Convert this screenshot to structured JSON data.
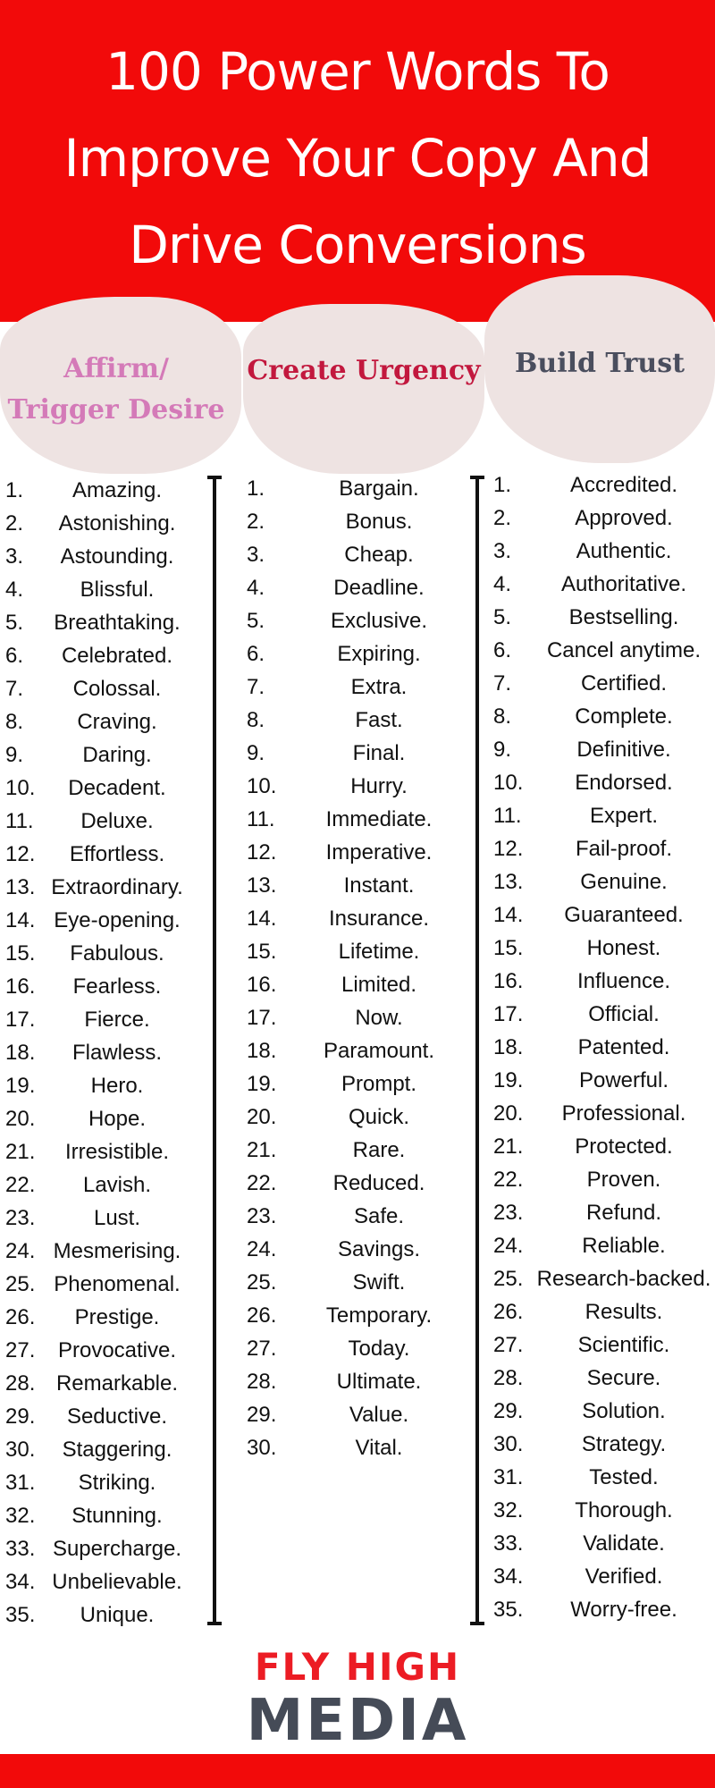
{
  "title": {
    "line1": "100 Power Words To",
    "line2": "Improve Your Copy And",
    "line3": "Drive Conversions"
  },
  "categories": {
    "affirm": {
      "line1": "Affirm/",
      "line2": "Trigger Desire"
    },
    "urgency": {
      "label": "Create Urgency"
    },
    "trust": {
      "label": "Build Trust"
    }
  },
  "affirm_words": [
    "Amazing.",
    "Astonishing.",
    "Astounding.",
    "Blissful.",
    "Breathtaking.",
    "Celebrated.",
    "Colossal.",
    "Craving.",
    "Daring.",
    "Decadent.",
    "Deluxe.",
    "Effortless.",
    "Extraordinary.",
    "Eye-opening.",
    "Fabulous.",
    "Fearless.",
    "Fierce.",
    "Flawless.",
    "Hero.",
    "Hope.",
    "Irresistible.",
    "Lavish.",
    "Lust.",
    "Mesmerising.",
    "Phenomenal.",
    "Prestige.",
    "Provocative.",
    "Remarkable.",
    "Seductive.",
    "Staggering.",
    "Striking.",
    "Stunning.",
    "Supercharge.",
    "Unbelievable.",
    "Unique."
  ],
  "urgency_words": [
    "Bargain.",
    "Bonus.",
    "Cheap.",
    "Deadline.",
    "Exclusive.",
    "Expiring.",
    "Extra.",
    "Fast.",
    "Final.",
    "Hurry.",
    "Immediate.",
    "Imperative.",
    "Instant.",
    "Insurance.",
    "Lifetime.",
    "Limited.",
    "Now.",
    "Paramount.",
    "Prompt.",
    "Quick.",
    "Rare.",
    "Reduced.",
    "Safe.",
    "Savings.",
    "Swift.",
    "Temporary.",
    "Today.",
    "Ultimate.",
    "Value.",
    "Vital."
  ],
  "trust_words": [
    "Accredited.",
    "Approved.",
    "Authentic.",
    "Authoritative.",
    "Bestselling.",
    "Cancel anytime.",
    "Certified.",
    "Complete.",
    "Definitive.",
    "Endorsed.",
    "Expert.",
    "Fail-proof.",
    "Genuine.",
    "Guaranteed.",
    "Honest.",
    "Influence.",
    "Official.",
    "Patented.",
    "Powerful.",
    "Professional.",
    "Protected.",
    "Proven.",
    "Refund.",
    "Reliable.",
    "Research-backed.",
    "Results.",
    "Scientific.",
    "Secure.",
    "Solution.",
    "Strategy.",
    "Tested.",
    "Thorough.",
    "Validate.",
    "Verified.",
    "Worry-free."
  ],
  "logo": {
    "line1": "FLY HIGH",
    "line2": "MEDIA"
  },
  "colors": {
    "brand_red": "#f20a0a",
    "affirm": "#d47ab8",
    "urgency": "#c2183e",
    "trust": "#4a4e5e",
    "logo_gray": "#454b57"
  }
}
